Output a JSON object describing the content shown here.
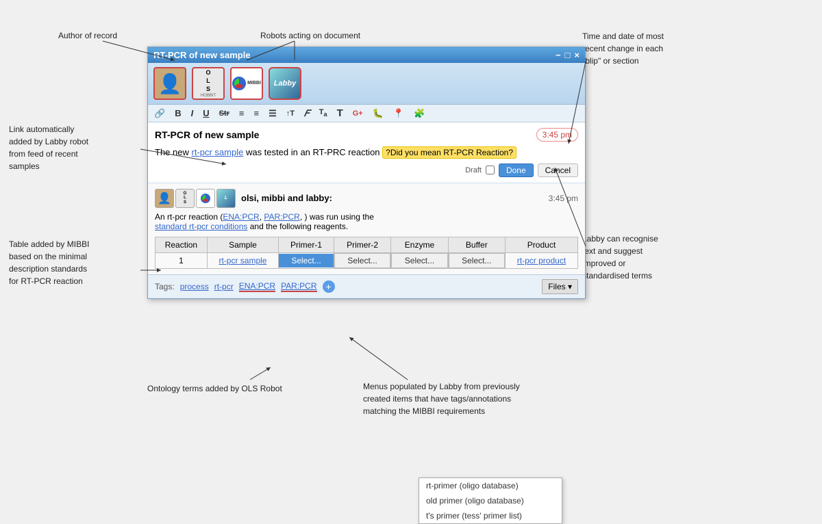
{
  "annotations": {
    "author_of_record": "Author of record",
    "robots_acting": "Robots acting on document",
    "time_date": "Time and date of most\nrecent change in each\n\"blip\" or section",
    "link_auto": "Link automatically\nadded by Labby robot\nfrom feed of recent\nsamples",
    "table_mibbi": "Table added by MIBBI\nbased on the minimal\ndescription standards\nfor RT-PCR reaction",
    "ontology_terms": "Ontology terms added by OLS Robot",
    "menus_populated": "Menus populated by Labby from previously\ncreated items that have tags/annotations\nmatching the MIBBI requirements",
    "labby_recognise": "Labby can recognise\ntext and suggest\nimproved or\nstandardised terms"
  },
  "window": {
    "title": "RT-PCR of new sample",
    "controls": {
      "minimize": "−",
      "maximize": "□",
      "close": "×"
    }
  },
  "avatars": [
    {
      "type": "person",
      "label": "person avatar"
    },
    {
      "type": "ols",
      "label": "OLS robot",
      "text": "O\nL\nS"
    },
    {
      "type": "mibbi",
      "label": "MIBBI robot"
    },
    {
      "type": "labby",
      "label": "Labby robot",
      "text": "Labby"
    }
  ],
  "toolbar": {
    "items": [
      "🔗",
      "B",
      "I",
      "U",
      "Str",
      "≡",
      "≡",
      "≡",
      "↑T",
      "𝐹",
      "T𝑎",
      "T",
      "G+",
      "🐛",
      "📍",
      "🧩"
    ]
  },
  "blip1": {
    "title": "RT-PCR of new sample",
    "time": "3:45 pm",
    "text_before": "The new ",
    "link": "rt-pcr sample",
    "text_middle": " was tested in an RT-PRC reaction ",
    "spell_suggestion": "?Did you mean RT-PCR Reaction?",
    "draft_label": "Draft",
    "done_button": "Done",
    "cancel_button": "Cancel"
  },
  "blip2": {
    "author": "olsi, mibbi and labby:",
    "time": "3:45 pm",
    "intro_text": "An rt-pcr reaction (",
    "link1": "ENA:PCR",
    "link2": "PAR:PCR",
    "intro_text2": ", ) was run using the",
    "link3": "standard rt-pcr conditions",
    "intro_text3": " and the following reagents."
  },
  "table": {
    "headers": [
      "Reaction",
      "Sample",
      "Primer-1",
      "Primer-2",
      "Enzyme",
      "Buffer",
      "Product"
    ],
    "rows": [
      {
        "reaction": "1",
        "sample_link": "rt-pcr sample",
        "primer1": "Select...",
        "primer2": "Select...",
        "enzyme": "Select...",
        "buffer": "Select...",
        "product_link": "rt-pcr product"
      }
    ],
    "primer1_selected": true,
    "select_label": "Select _"
  },
  "dropdown": {
    "items": [
      "rt-primer (oligo database)",
      "old primer (oligo database)",
      "t's primer (tess' primer list)"
    ]
  },
  "tags": {
    "label": "Tags:",
    "items": [
      "process",
      "rt-pcr",
      "ENA:PCR",
      "PAR:PCR"
    ],
    "add_icon": "+",
    "files_button": "Files ▾"
  }
}
